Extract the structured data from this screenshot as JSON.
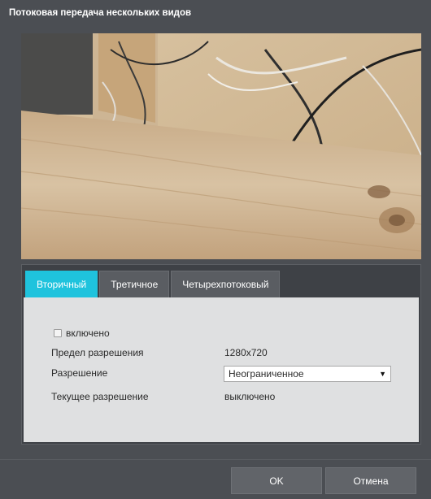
{
  "dialog": {
    "title": "Потоковая передача нескольких видов"
  },
  "video": {
    "description_icon": "camera-feed"
  },
  "tabs": [
    {
      "label": "Вторичный",
      "active": true
    },
    {
      "label": "Третичное",
      "active": false
    },
    {
      "label": "Четырехпотоковый",
      "active": false
    }
  ],
  "settings": {
    "enabled_label": "включено",
    "enabled_checked": false,
    "resolution_limit_label": "Предел разрешения",
    "resolution_limit_value": "1280x720",
    "resolution_label": "Разрешение",
    "resolution_selected": "Неограниченное",
    "current_resolution_label": "Текущее разрешение",
    "current_resolution_value": "выключено"
  },
  "buttons": {
    "ok": "OK",
    "cancel": "Отмена"
  },
  "colors": {
    "accent": "#1fc3dd",
    "background": "#4b4e53"
  }
}
